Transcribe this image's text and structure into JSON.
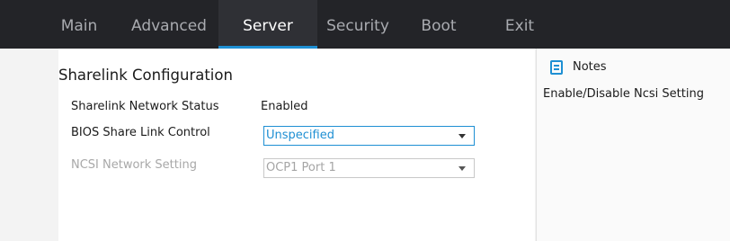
{
  "tabs": [
    {
      "label": "Main"
    },
    {
      "label": "Advanced"
    },
    {
      "label": "Server"
    },
    {
      "label": "Security"
    },
    {
      "label": "Boot"
    },
    {
      "label": "Exit"
    }
  ],
  "active_tab": "Server",
  "section_title": "Sharelink Configuration",
  "settings": [
    {
      "label": "Sharelink Network Status",
      "value": "Enabled",
      "state": "read-only"
    },
    {
      "label": "BIOS Share Link Control",
      "value": "Unspecified",
      "state": "focused"
    },
    {
      "label": "NCSI Network Setting",
      "value": "OCP1 Port 1",
      "state": "disabled"
    }
  ],
  "notes": {
    "title": "Notes",
    "icon": "notes-icon",
    "text": "Enable/Disable Ncsi Setting"
  },
  "colors": {
    "top_bar": "#232428",
    "active_tab_bg": "#2f3035",
    "accent": "#1e8fd3",
    "disabled_text": "#a8a8a8"
  }
}
